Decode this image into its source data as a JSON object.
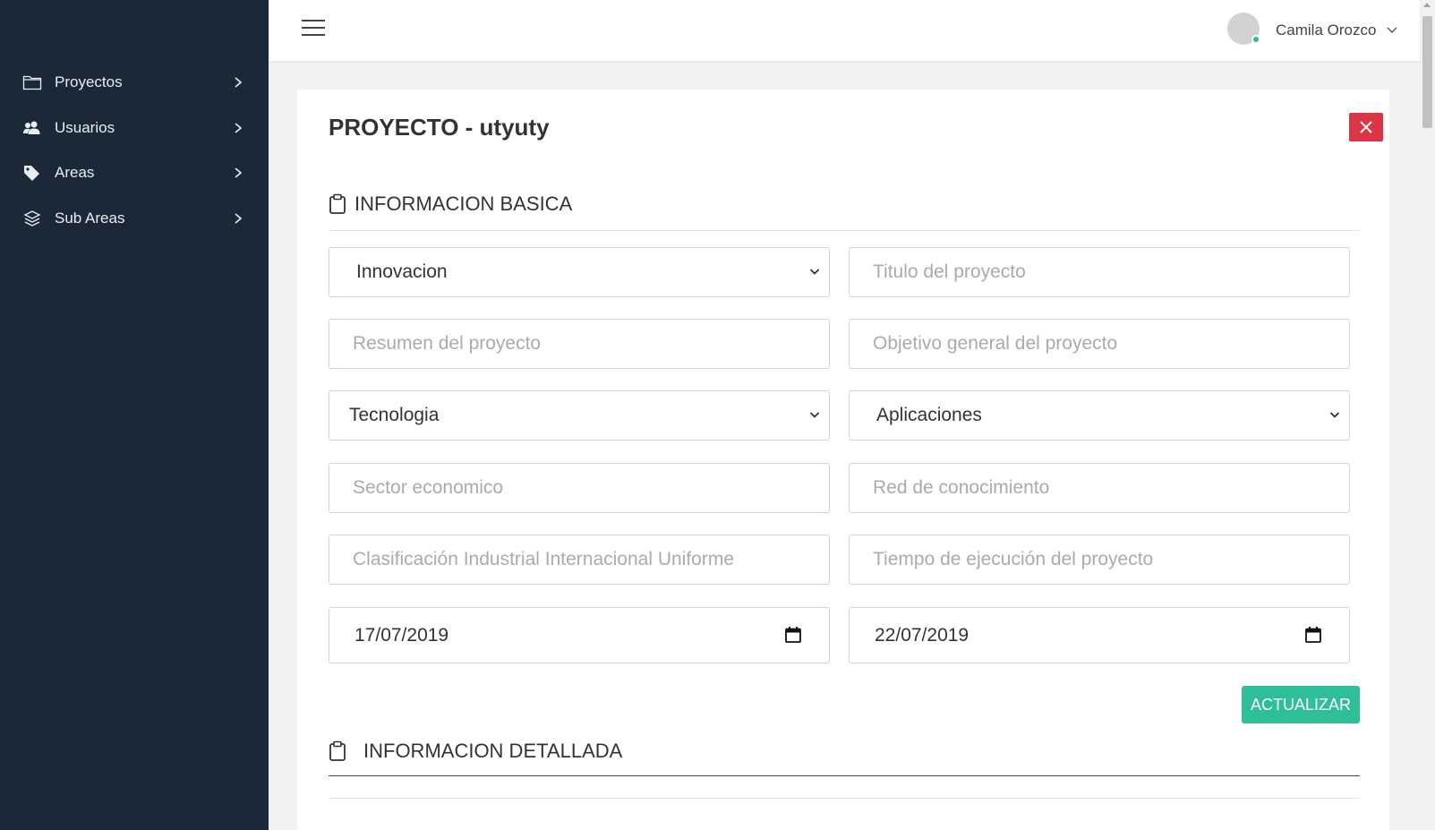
{
  "sidebar": {
    "items": [
      {
        "label": "Proyectos",
        "icon": "folder-icon"
      },
      {
        "label": "Usuarios",
        "icon": "users-icon"
      },
      {
        "label": "Areas",
        "icon": "tag-icon"
      },
      {
        "label": "Sub Areas",
        "icon": "layers-icon"
      }
    ]
  },
  "header": {
    "user_name": "Camila Orozco",
    "status_color": "#2bbf8c"
  },
  "page": {
    "title_prefix": "PROYECTO - ",
    "title_name": "utyuty"
  },
  "sections": {
    "basic": "INFORMACION BASICA",
    "detailed": "INFORMACION DETALLADA"
  },
  "form": {
    "tipo": "Innovacion",
    "titulo_placeholder": "Titulo del proyecto",
    "resumen_placeholder": "Resumen del proyecto",
    "objetivo_placeholder": "Objetivo general del proyecto",
    "area": "Tecnologia",
    "sub_area": "Aplicaciones",
    "sector_placeholder": "Sector economico",
    "red_placeholder": "Red de conocimiento",
    "ciiu_placeholder": "Clasificación Industrial Internacional Uniforme",
    "tiempo_placeholder": "Tiempo de ejecución del proyecto",
    "fecha_inicio": "17/07/2019",
    "fecha_fin": "22/07/2019",
    "update_button": "ACTUALIZAR"
  },
  "colors": {
    "sidebar_bg": "#1b2838",
    "close_button": "#dc3545",
    "update_button": "#2ebf9a"
  }
}
